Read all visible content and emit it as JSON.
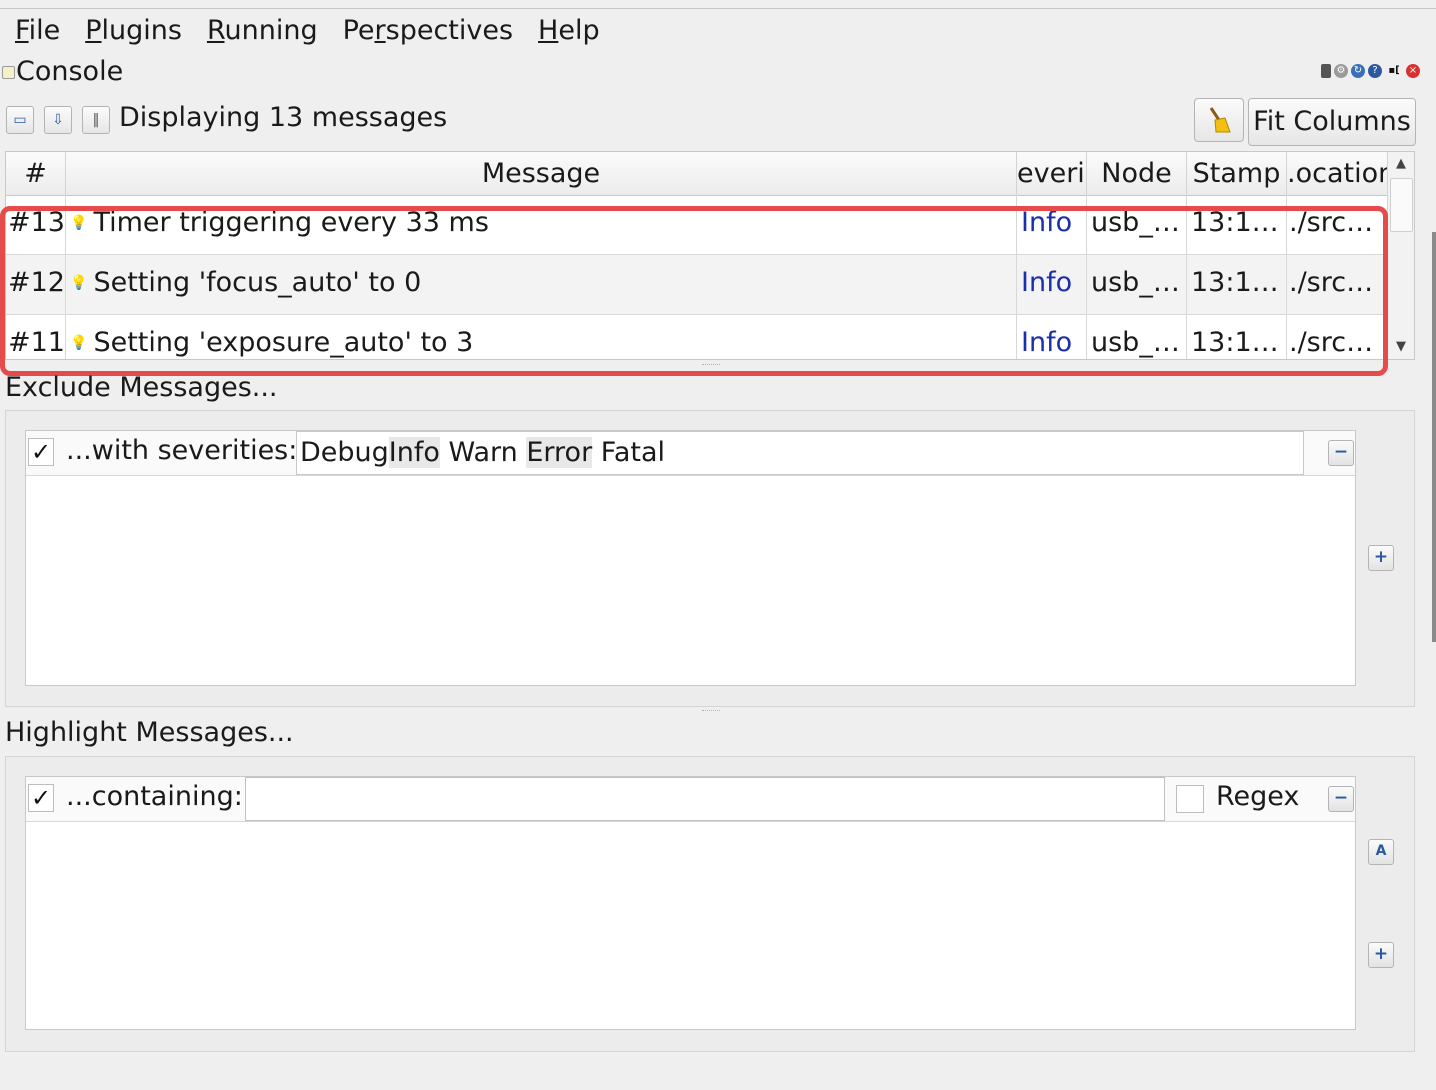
{
  "menu": [
    {
      "label": "File",
      "mnemonic": "F",
      "rest": "ile"
    },
    {
      "label": "Plugins",
      "mnemonic": "P",
      "rest": "lugins"
    },
    {
      "label": "Running",
      "mnemonic": "R",
      "rest": "unning"
    },
    {
      "label": "Perspectives",
      "mnemonic_prefix": "Pe",
      "mnemonic": "r",
      "rest": "spectives"
    },
    {
      "label": "Help",
      "mnemonic": "H",
      "rest": "elp"
    }
  ],
  "console": {
    "title": "Console",
    "status": "Displaying 13 messages",
    "fit_columns_label": "Fit Columns"
  },
  "icons": {
    "save": "save-icon",
    "load": "open-icon",
    "pause": "pause-icon",
    "clear": "broom-icon"
  },
  "table": {
    "columns": [
      "#",
      "Message",
      "Severity",
      "Node",
      "Stamp",
      "Location"
    ],
    "column_display": [
      "#",
      "Message",
      "everi",
      "Node",
      "Stamp",
      ".ocation"
    ],
    "rows": [
      {
        "num": "#13",
        "message": "Timer triggering every 33 ms",
        "severity": "Info",
        "node": "usb_…",
        "stamp": "13:1…",
        "location": "./src…"
      },
      {
        "num": "#12",
        "message": "Setting 'focus_auto' to 0",
        "severity": "Info",
        "node": "usb_…",
        "stamp": "13:1…",
        "location": "./src…"
      },
      {
        "num": "#11",
        "message": "Setting 'exposure_auto' to 3",
        "severity": "Info",
        "node": "usb_…",
        "stamp": "13:1…",
        "location": "./src…"
      }
    ]
  },
  "exclude": {
    "title": "Exclude Messages...",
    "filter_label": "...with severities:",
    "checked": true,
    "severities": [
      "Debug",
      "Info",
      "Warn",
      "Error",
      "Fatal"
    ],
    "selected": [
      "Info",
      "Error"
    ]
  },
  "highlight": {
    "title": "Highlight Messages...",
    "filter_label": "...containing:",
    "checked": true,
    "text_value": "",
    "regex_label": "Regex",
    "regex_checked": false
  },
  "colors": {
    "severity_info": "#1a2faa",
    "annotation": "#e54b4b"
  }
}
